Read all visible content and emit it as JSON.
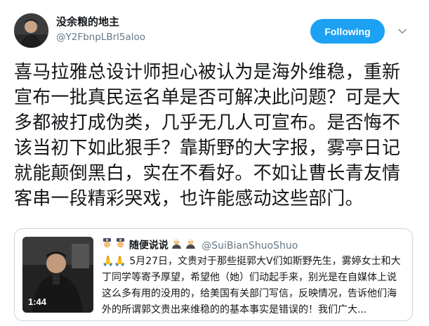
{
  "author": {
    "name": "没余粮的地主",
    "handle": "@Y2FbnpLBrl5aloo"
  },
  "follow_button": {
    "label": "Following"
  },
  "tweet": {
    "text": "喜马拉雅总设计师担心被认为是海外维稳，重新宣布一批真民运名单是否可解决此问题？可是大多都被打成伪类，几乎无几人可宣布。是否悔不该当初下如此狠手？靠斯野的大字报，雾亭日记就能颠倒黑白，实在不看好。不如让曹长青友情客串一段精彩哭戏，也许能感动这些部门。"
  },
  "quoted_tweet": {
    "name": "随便说说",
    "handle": "@SuiBianShuoShuo",
    "body": "🙏🙏 5月27日，文贵对于那些挺郭大V们如斯野先生，雾婷女士和大丁同学等寄予厚望，希望他（她）们动起手来，别光是在自媒体上说这么多有用的没用的，给美国有关部门写信，反映情况，告诉他们海外的所谓郭文贵出来维稳的的基本事实是错误的！我们广大...",
    "video_duration": "1:44"
  },
  "icons": {
    "caret": "chevron-down-icon",
    "police_emoji": "police-officer-icon",
    "judge_emoji": "judge-icon"
  },
  "colors": {
    "accent": "#1da1f2",
    "secondary_text": "#657786",
    "border": "#ccd6dd"
  }
}
